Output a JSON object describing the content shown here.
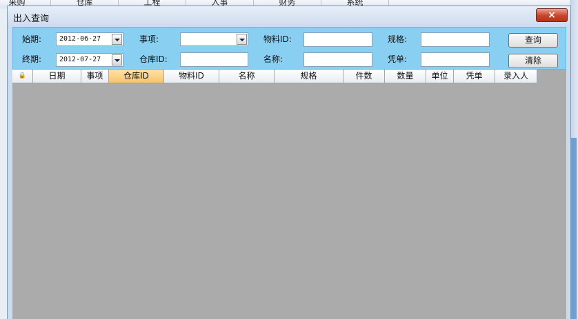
{
  "background_menu": [
    "采购",
    "仓库",
    "工程",
    "人事",
    "财务",
    "系统"
  ],
  "window": {
    "title": "出入查询",
    "close_label": "×"
  },
  "filters": {
    "start_label": "始期:",
    "start_value": "2012-06-27",
    "end_label": "终期:",
    "end_value": "2012-07-27",
    "item_label": "事项:",
    "item_value": "",
    "warehouse_label": "仓库ID:",
    "warehouse_value": "",
    "material_label": "物料ID:",
    "material_value": "",
    "name_label": "名称:",
    "name_value": "",
    "spec_label": "规格:",
    "spec_value": "",
    "voucher_label": "凭单:",
    "voucher_value": "",
    "query_button": "查询",
    "clear_button": "清除"
  },
  "grid": {
    "corner_glyph": "🔒",
    "columns": [
      "日期",
      "事项",
      "仓库ID",
      "物料ID",
      "名称",
      "规格",
      "件数",
      "数量",
      "单位",
      "凭单",
      "录入人"
    ],
    "active_column": "仓库ID",
    "rows": []
  },
  "colors": {
    "filter_panel": "#89cff2",
    "grid_background": "#ababab",
    "active_header": "#f7c46b"
  }
}
